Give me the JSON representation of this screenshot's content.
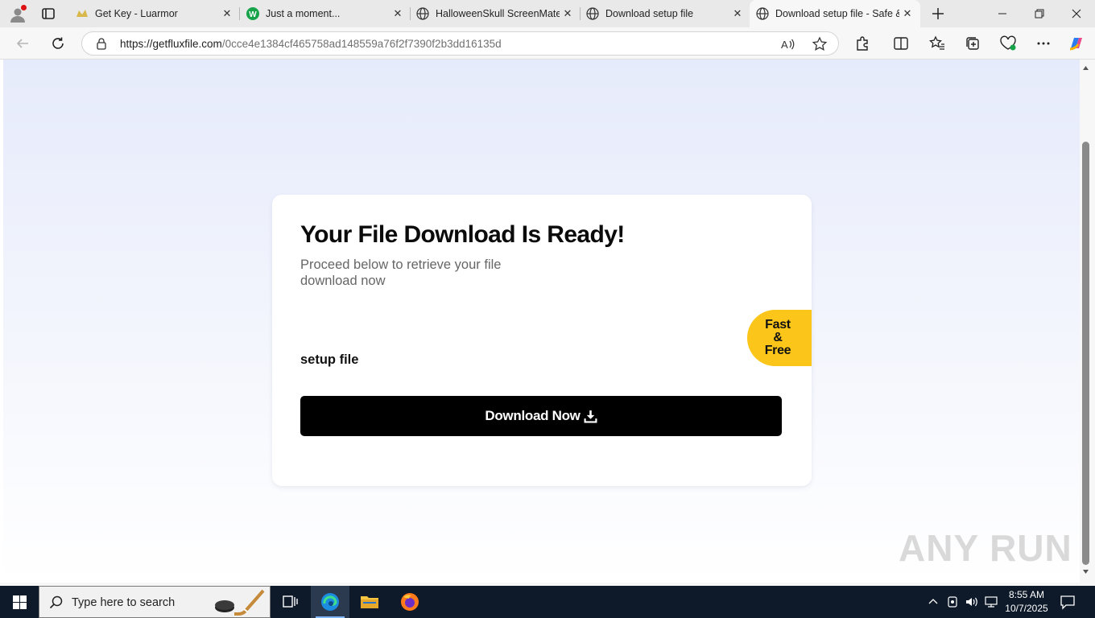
{
  "browser": {
    "tabs": [
      {
        "title": "Get Key - Luarmor",
        "favicon": "luarmor-icon"
      },
      {
        "title": "Just a moment...",
        "favicon": "w-logo-icon"
      },
      {
        "title": "HalloweenSkull ScreenMate",
        "favicon": "globe-icon"
      },
      {
        "title": "Download setup file",
        "favicon": "globe-icon"
      },
      {
        "title": "Download setup file - Safe & Fast",
        "favicon": "globe-icon",
        "active": true
      }
    ],
    "url_host": "https://getfluxfile.com",
    "url_path": "/0cce4e1384cf465758ad148559a76f2f7390f2b3dd16135d"
  },
  "page": {
    "heading": "Your File Download Is Ready!",
    "subtitle": "Proceed below to retrieve your file download now",
    "badge": "Fast & Free",
    "file_name": "setup file",
    "download_button": "Download Now"
  },
  "watermark": "ANY RUN",
  "taskbar": {
    "search_placeholder": "Type here to search",
    "time": "8:55 AM",
    "date": "10/7/2025"
  },
  "colors": {
    "badge": "#fbc51a",
    "button": "#000000",
    "taskbar": "#0e1a2a",
    "page_gradient_top": "#e6ebfb"
  }
}
